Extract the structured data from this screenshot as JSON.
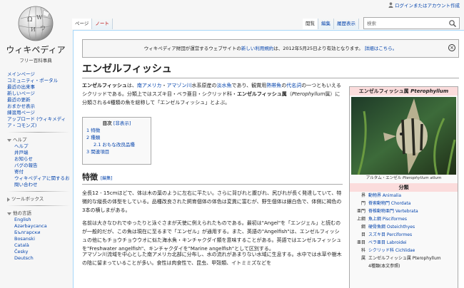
{
  "personal": {
    "login_label": "ログインまたはアカウント作成"
  },
  "logo": {
    "title": "ウィキペディア",
    "tagline": "フリー百科事典"
  },
  "sidebar": {
    "nav": [
      "メインページ",
      "コミュニティ・ポータル",
      "最近の出来事",
      "新しいページ",
      "最近の更新",
      "おまかせ表示",
      "練習用ページ",
      "アップロード (ウィキメディア・コモンズ)"
    ],
    "help_heading": "ヘルプ",
    "help_items": [
      "ヘルプ",
      "井戸端",
      "お知らせ",
      "バグの報告",
      "寄付",
      "ウィキペディアに関するお問い合わせ"
    ],
    "toolbox_heading": "ツールボックス",
    "lang_heading": "他の言語",
    "languages": [
      "English",
      "Azərbaycanca",
      "Български",
      "Bosanski",
      "Català",
      "Česky",
      "Deutsch"
    ]
  },
  "tabs": {
    "page": "ページ",
    "talk": "ノート",
    "read": "閲覧",
    "edit": "編集",
    "history": "履歴表示"
  },
  "search": {
    "placeholder": "検索"
  },
  "notice": {
    "text_before": "ウィキペディア財団が運営するウェブサイトの",
    "link": "新しい利用規約",
    "text_after": "は、2012年5月25日より有効となります。",
    "details": "詳細はこちら。"
  },
  "article": {
    "title": "エンゼルフィッシュ",
    "intro": {
      "term": "エンゼルフィッシュ",
      "t1": "は、",
      "l1": "南アメリカ",
      "t2": "・",
      "l2": "アマゾン川",
      "t3": "水系原産の",
      "l3": "淡水魚",
      "t4": "であり、観賞用",
      "l4": "熱帯魚",
      "t5": "の",
      "l5": "代名詞",
      "t6": "の一つともいえるシクリッドである。分類上ではスズキ目・ベラ亜目・シクリッド科・",
      "term2": "エンゼルフィッシュ属",
      "t7": "（",
      "sci": "Pterophyllum",
      "t8": "属）に分類される4種類の魚を総称して「エンゼルフィッシュ」とよぶ。"
    },
    "toc": {
      "title": "目次",
      "toggle": "[非表示]",
      "items": [
        "1 特徴",
        "2 種類",
        "2.1 おもな改良品種",
        "3 関連項目"
      ]
    },
    "section1": {
      "heading": "特徴",
      "edit": "[編集]"
    },
    "p1": "全長12 - 15cmほどで、体は木の葉のように左右に平たい。さらに背びれと腹びれ、尻びれが長く発達していて、特徴的な縦長の体型をしている。品種改良された飼育個体の体色は変異に富むが、野生個体は銀白色で、体側に褐色の3本の横しまがある。",
    "p2": "名前は大きなひれでゆったりと泳ぐさまが天使に例えられたものである。最初は\"Angel\"を「エンジェル」と読むのが一般的だが、この魚は現在に至るまで「エンゼル」が通用する。また、英語の\"Angelfish\"は、エンゼルフィッシュの他にもチョウチョウウオに似た海水魚・キンチャクダイ類を意味することがある。英語ではエンゼルフィッシュを\"Freshwater angelfish\"、キンチャクダイを\"Marine angelfish\"として区別する。",
    "p3": "アマゾン川流域を中心とした南アメリカ北部に分布し、水の流れがあまりない水域に生息する。水中では水草や樹木の陰に留まっていることが多い。食性は肉食性で、昆虫、甲殻類、イトミミズなどを"
  },
  "infobox": {
    "title_jp": "エンゼルフィッシュ属",
    "title_sci": "Pterophyllum",
    "caption": "アルタム・エンゼル",
    "caption_sci": "Pterophyllum altum",
    "classification": "分類",
    "rows": [
      {
        "rank": "界",
        "name": "動物界 Animalia"
      },
      {
        "rank": "門",
        "name": "脊索動物門 Chordata"
      },
      {
        "rank": "亜門",
        "name": "脊椎動物亜門 Vertebrata"
      },
      {
        "rank": "上綱",
        "name": "魚上綱 Pisciformes"
      },
      {
        "rank": "綱",
        "name": "硬骨魚綱 Osteichthyes"
      },
      {
        "rank": "目",
        "name": "スズキ目 Perciformes"
      },
      {
        "rank": "亜目",
        "name": "ベラ亜目 Labroidei"
      },
      {
        "rank": "科",
        "name": "シクリッド科 Cichlidae"
      },
      {
        "rank": "属",
        "name": "エンゼルフィッシュ属 Pterophyllum"
      },
      {
        "rank": "",
        "name": "4種類(本文参照)"
      }
    ]
  },
  "colors": {
    "link": "#0645ad",
    "infobox_header": "#fbdcdc",
    "border": "#a7d7f9"
  }
}
